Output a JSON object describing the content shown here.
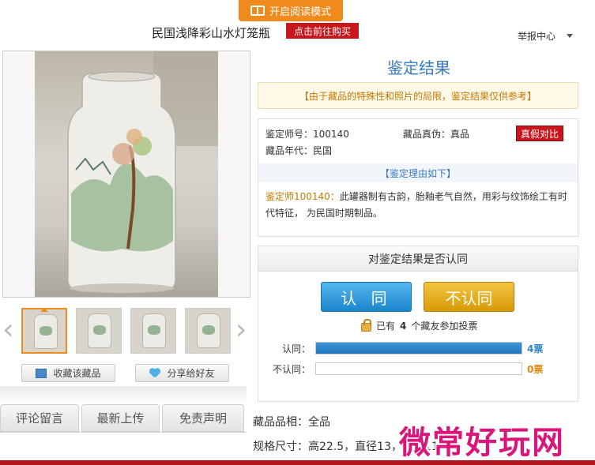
{
  "top_banner": {
    "label": "开启阅读模式"
  },
  "header": {
    "title": "民国浅降彩山水灯笼瓶",
    "buy_label": "点击前往购买",
    "report_label": "举报中心"
  },
  "gallery": {
    "thumbs": [
      "thumb-1",
      "thumb-2",
      "thumb-3",
      "thumb-4"
    ],
    "active_index": 0
  },
  "actions": {
    "collect_label": "收藏该藏品",
    "share_label": "分享给好友"
  },
  "tabs": [
    "评论留言",
    "最新上传",
    "免责声明"
  ],
  "result": {
    "title": "鉴定结果",
    "notice": "【由于藏品的特殊性和照片的局限，鉴定结果仅供参考】",
    "expert_label": "鉴定师号：",
    "expert_id": "100140",
    "authenticity_label": "藏品真伪：",
    "authenticity_value": "真品",
    "compare_label": "真假对比",
    "era_label": "藏品年代：",
    "era_value": "民国",
    "reason_header": "【鉴定理由如下】",
    "reason_expert": "鉴定师100140：",
    "reason_text": "此罐器制有古韵，胎釉老气自然，用彩与纹饰绘工有时代特征， 为民国时期制品。"
  },
  "vote": {
    "question": "对鉴定结果是否认同",
    "agree_button": "认 同",
    "disagree_button": "不认同",
    "count_prefix": "已有",
    "count": "4",
    "count_suffix": "个藏友参加投票",
    "agree_label": "认同：",
    "agree_votes": "4票",
    "agree_fraction": 1.0,
    "disagree_label": "不认同：",
    "disagree_votes": "0票",
    "disagree_fraction": 0.0
  },
  "properties": {
    "condition": "藏品品相：全品",
    "size": "规格尺寸：高22.5，直径13，口径11"
  },
  "watermark": "微常好玩网",
  "colors": {
    "accent_orange": "#f08a1c",
    "brand_red": "#c8161d",
    "link_blue": "#3a7bbf",
    "watermark": "#d9177a"
  }
}
